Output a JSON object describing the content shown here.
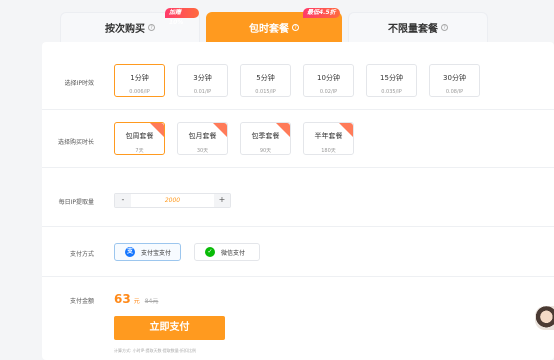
{
  "tabs": [
    {
      "label": "按次购买",
      "help": "?",
      "badge": "加赠10%"
    },
    {
      "label": "包时套餐",
      "help": "?",
      "badge": "最低4.5折"
    },
    {
      "label": "不限量套餐",
      "help": "?",
      "badge": ""
    }
  ],
  "ip_duration": {
    "label": "选择IP时效",
    "options": [
      {
        "title": "1分钟",
        "price": "0.006/IP"
      },
      {
        "title": "3分钟",
        "price": "0.01/IP"
      },
      {
        "title": "5分钟",
        "price": "0.015/IP"
      },
      {
        "title": "10分钟",
        "price": "0.02/IP"
      },
      {
        "title": "15分钟",
        "price": "0.035/IP"
      },
      {
        "title": "30分钟",
        "price": "0.08/IP"
      }
    ],
    "selected_index": 0
  },
  "purchase_period": {
    "label": "选择购买时长",
    "options": [
      {
        "title": "包周套餐",
        "days": "7天"
      },
      {
        "title": "包月套餐",
        "days": "30天"
      },
      {
        "title": "包季套餐",
        "days": "90天"
      },
      {
        "title": "半年套餐",
        "days": "180天"
      }
    ],
    "selected_index": 0
  },
  "daily_ip": {
    "label": "每日IP提取量",
    "minus": "-",
    "value": "2000",
    "plus": "+"
  },
  "payment_method": {
    "label": "支付方式",
    "options": [
      {
        "label": "支付宝支付",
        "icon": "alipay-icon",
        "icon_glyph": "支",
        "color": "#1677ff"
      },
      {
        "label": "微信支付",
        "icon": "wechat-icon",
        "icon_glyph": "✓",
        "color": "#09bb07"
      }
    ],
    "selected_index": 0
  },
  "amount": {
    "label": "支付金额",
    "price": "63",
    "unit": "元",
    "original": "84元"
  },
  "pay_button": "立即支付",
  "footnote": "计算方式: 小时IP·提取天数·提取数量·折扣比例",
  "colors": {
    "accent": "#ff9a1f",
    "badge": "#ff4d5e"
  }
}
